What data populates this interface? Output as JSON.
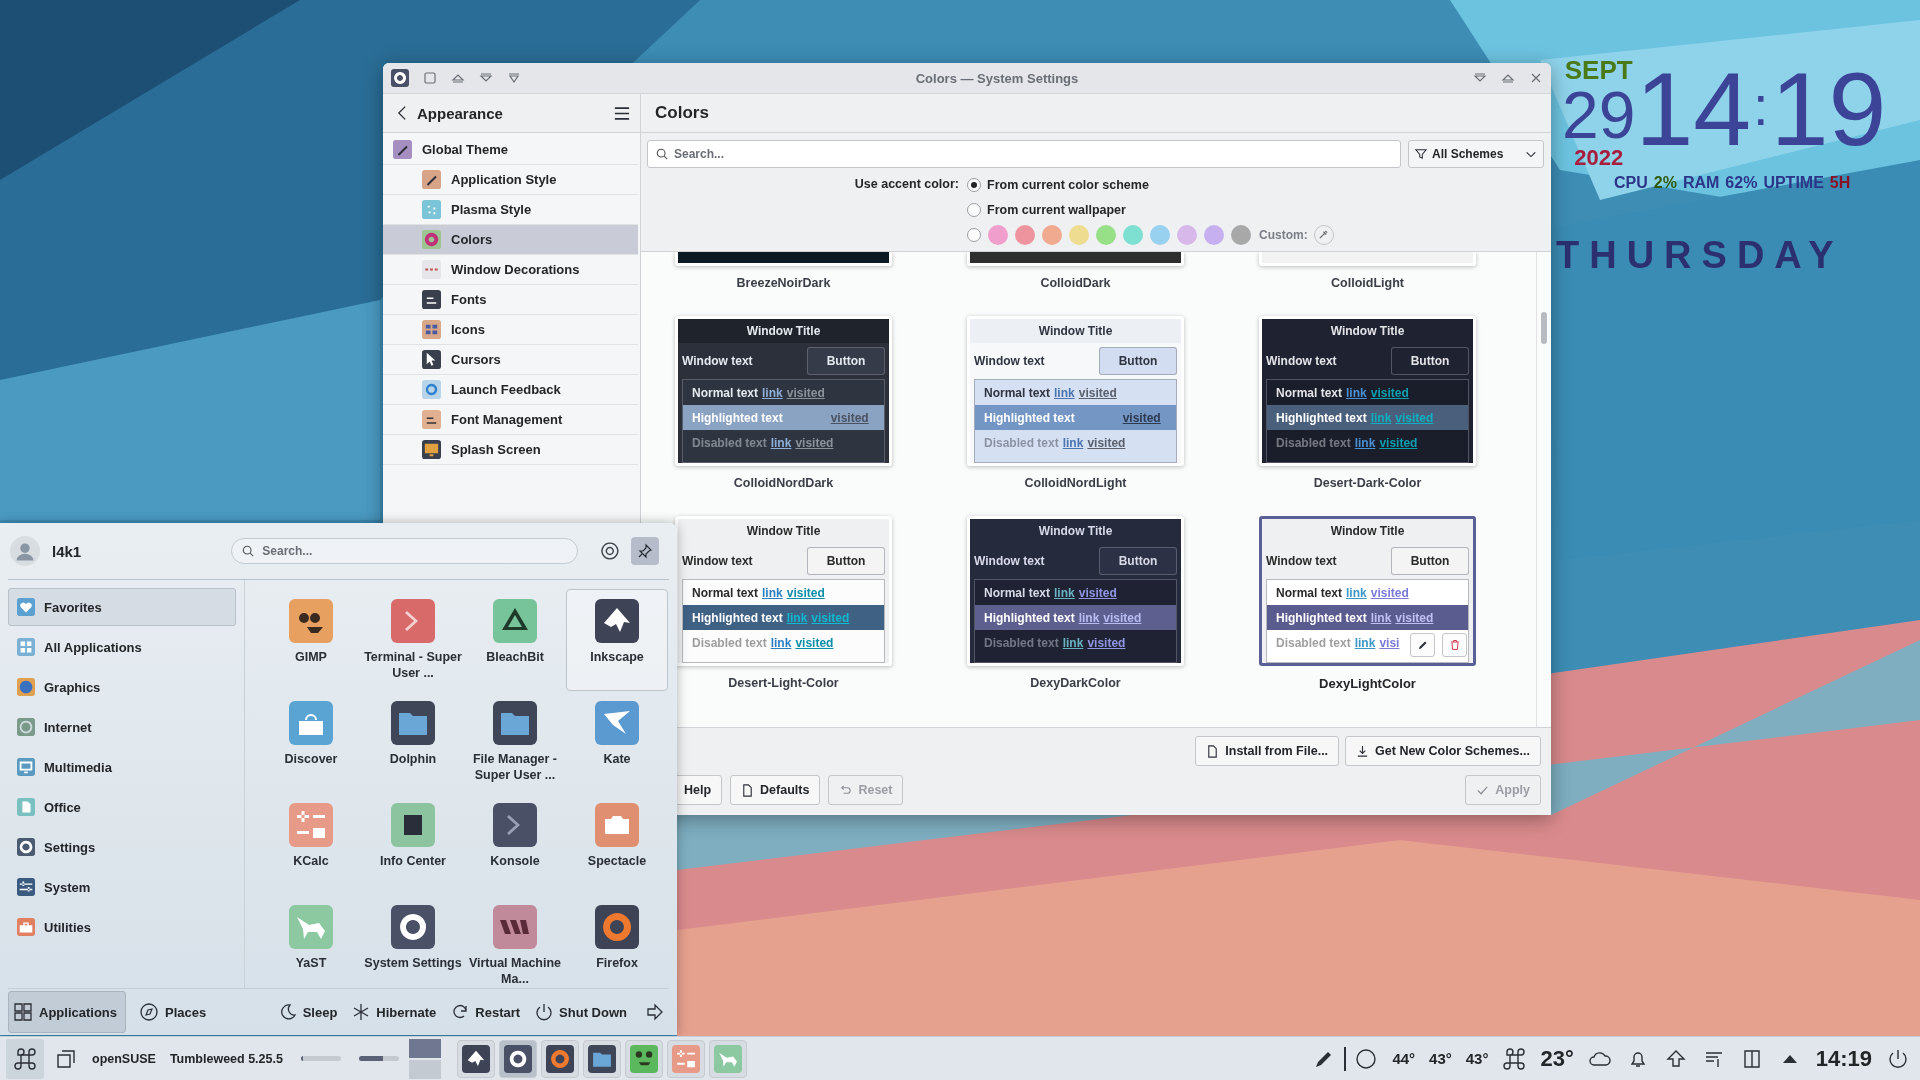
{
  "clock": {
    "month": "SEPT",
    "day": "29",
    "year": "2022",
    "hours": "14",
    "separator": ":",
    "minutes": "19",
    "stats": [
      {
        "label": "CPU",
        "value": "2%"
      },
      {
        "label": "RAM",
        "value": "62%"
      },
      {
        "label": "UPTIME",
        "value": "5H"
      }
    ],
    "weekday": "THURSDAY"
  },
  "window": {
    "title": "Colors — System Settings"
  },
  "sidebar": {
    "title": "Appearance",
    "items": [
      {
        "label": "Global Theme",
        "selected": false,
        "children": [
          {
            "label": "Application Style",
            "selected": false
          },
          {
            "label": "Plasma Style",
            "selected": false
          },
          {
            "label": "Colors",
            "selected": true
          },
          {
            "label": "Window Decorations",
            "selected": false
          },
          {
            "label": "Fonts",
            "selected": false
          },
          {
            "label": "Icons",
            "selected": false
          },
          {
            "label": "Cursors",
            "selected": false
          },
          {
            "label": "Launch Feedback",
            "selected": false
          },
          {
            "label": "Font Management",
            "selected": false
          },
          {
            "label": "Splash Screen",
            "selected": false
          }
        ]
      }
    ]
  },
  "page": {
    "title": "Colors",
    "search": {
      "placeholder": "Search..."
    },
    "filter": "All Schemes",
    "accent": {
      "label": "Use accent color:",
      "options": [
        {
          "kind": "text",
          "label": "From current color scheme",
          "selected": true
        },
        {
          "kind": "text",
          "label": "From current wallpaper",
          "selected": false
        },
        {
          "kind": "swatches",
          "selected": false
        }
      ],
      "swatches": [
        {
          "color": "#f09ecb"
        },
        {
          "color": "#ee949e"
        },
        {
          "color": "#f0aa90"
        },
        {
          "color": "#eedc90"
        },
        {
          "color": "#98e088"
        },
        {
          "color": "#7ee0d0"
        },
        {
          "color": "#98d0f0"
        },
        {
          "color": "#d8b8ea"
        },
        {
          "color": "#c6b0f0"
        },
        {
          "color": "#a8a8a8"
        }
      ],
      "custom": "Custom:"
    },
    "schemes": [
      {
        "name": "BreezeNoirDark",
        "selected": false,
        "kind": "cut"
      },
      {
        "name": "ColloidDark",
        "selected": false,
        "kind": "cut"
      },
      {
        "name": "ColloidLight",
        "selected": false,
        "kind": "cut"
      },
      {
        "name": "ColloidNordDark",
        "selected": false,
        "kind": "full",
        "preview": {
          "title": "Window Title",
          "text": "Window text",
          "button": "Button",
          "rows": [
            {
              "kind": "normal",
              "text": "Normal text",
              "link": "link",
              "visited": "visited"
            },
            {
              "kind": "highlighted",
              "text": "Highlighted text",
              "visited": "visited"
            },
            {
              "kind": "disabled",
              "text": "Disabled text",
              "link": "link",
              "visited": "visited"
            }
          ]
        }
      },
      {
        "name": "ColloidNordLight",
        "selected": false,
        "kind": "full",
        "preview": {
          "title": "Window Title",
          "text": "Window text",
          "button": "Button",
          "rows": [
            {
              "kind": "normal",
              "text": "Normal text",
              "link": "link",
              "visited": "visited"
            },
            {
              "kind": "highlighted",
              "text": "Highlighted text",
              "visited": "visited"
            },
            {
              "kind": "disabled",
              "text": "Disabled text",
              "link": "link",
              "visited": "visited"
            }
          ]
        }
      },
      {
        "name": "Desert-Dark-Color",
        "selected": false,
        "kind": "full",
        "preview": {
          "title": "Window Title",
          "text": "Window text",
          "button": "Button",
          "rows": [
            {
              "kind": "normal",
              "text": "Normal text",
              "link": "link",
              "visited": "visited"
            },
            {
              "kind": "highlighted",
              "text": "Highlighted text",
              "link": "link",
              "visited": "visited"
            },
            {
              "kind": "disabled",
              "text": "Disabled text",
              "link": "link",
              "visited": "visited"
            }
          ]
        }
      },
      {
        "name": "Desert-Light-Color",
        "selected": false,
        "kind": "full",
        "preview": {
          "title": "Window Title",
          "text": "Window text",
          "button": "Button",
          "rows": [
            {
              "kind": "normal",
              "text": "Normal text",
              "link": "link",
              "visited": "visited"
            },
            {
              "kind": "highlighted",
              "text": "Highlighted text",
              "link": "link",
              "visited": "visited"
            },
            {
              "kind": "disabled",
              "text": "Disabled text",
              "link": "link",
              "visited": "visited"
            }
          ]
        }
      },
      {
        "name": "DexyDarkColor",
        "selected": false,
        "kind": "full",
        "preview": {
          "title": "Window Title",
          "text": "Window text",
          "button": "Button",
          "rows": [
            {
              "kind": "normal",
              "text": "Normal text",
              "link": "link",
              "visited": "visited"
            },
            {
              "kind": "highlighted",
              "text": "Highlighted text",
              "link": "link",
              "visited": "visited"
            },
            {
              "kind": "disabled",
              "text": "Disabled text",
              "link": "link",
              "visited": "visited"
            }
          ]
        }
      },
      {
        "name": "DexyLightColor",
        "selected": true,
        "kind": "full",
        "preview": {
          "title": "Window Title",
          "text": "Window text",
          "button": "Button",
          "rows": [
            {
              "kind": "normal",
              "text": "Normal text",
              "link": "link",
              "visited": "visited"
            },
            {
              "kind": "highlighted",
              "text": "Highlighted text",
              "link": "link",
              "visited": "visited"
            },
            {
              "kind": "disabled",
              "text": "Disabled text",
              "link": "link",
              "visited": "visi"
            }
          ]
        }
      }
    ],
    "actions": [
      {
        "kind": "install",
        "label": "Install from File..."
      },
      {
        "kind": "download",
        "label": "Get New Color Schemes..."
      }
    ]
  },
  "footer": {
    "buttons": [
      {
        "kind": "help",
        "label": "Help",
        "disabled": false
      },
      {
        "kind": "defaults",
        "label": "Defaults",
        "disabled": false
      },
      {
        "kind": "reset",
        "label": "Reset",
        "disabled": true
      }
    ],
    "apply": {
      "label": "Apply",
      "disabled": true
    }
  },
  "launcher": {
    "user": "l4k1",
    "search": {
      "placeholder": "Search..."
    },
    "pinned": true,
    "categories": [
      {
        "label": "Favorites",
        "selected": true
      },
      {
        "label": "All Applications",
        "selected": false
      },
      {
        "label": "Graphics",
        "selected": false
      },
      {
        "label": "Internet",
        "selected": false
      },
      {
        "label": "Multimedia",
        "selected": false
      },
      {
        "label": "Office",
        "selected": false
      },
      {
        "label": "Settings",
        "selected": false
      },
      {
        "label": "System",
        "selected": false
      },
      {
        "label": "Utilities",
        "selected": false
      }
    ],
    "apps": [
      {
        "kind": "gimp",
        "name": "GIMP",
        "selected": false
      },
      {
        "kind": "terminal",
        "name": "Terminal - Super User ...",
        "selected": false
      },
      {
        "kind": "bleachbit",
        "name": "BleachBit",
        "selected": false
      },
      {
        "kind": "inkscape",
        "name": "Inkscape",
        "selected": true
      },
      {
        "kind": "discover",
        "name": "Discover",
        "selected": false
      },
      {
        "kind": "dolphin",
        "name": "Dolphin",
        "selected": false
      },
      {
        "kind": "filemanager",
        "name": "File Manager - Super User ...",
        "selected": false
      },
      {
        "kind": "kate",
        "name": "Kate",
        "selected": false
      },
      {
        "kind": "kcalc",
        "name": "KCalc",
        "selected": false
      },
      {
        "kind": "infocenter",
        "name": "Info Center",
        "selected": false
      },
      {
        "kind": "konsole",
        "name": "Konsole",
        "selected": false
      },
      {
        "kind": "spectacle",
        "name": "Spectacle",
        "selected": false
      },
      {
        "kind": "yast",
        "name": "YaST",
        "selected": false
      },
      {
        "kind": "settings",
        "name": "System Settings",
        "selected": false
      },
      {
        "kind": "vm",
        "name": "Virtual Machine Ma...",
        "selected": false
      },
      {
        "kind": "firefox",
        "name": "Firefox",
        "selected": false
      }
    ],
    "tabs": [
      {
        "kind": "applications",
        "label": "Applications",
        "selected": true
      },
      {
        "kind": "places",
        "label": "Places",
        "selected": false
      }
    ],
    "power": [
      {
        "kind": "sleep",
        "label": "Sleep"
      },
      {
        "kind": "hibernate",
        "label": "Hibernate"
      },
      {
        "kind": "restart",
        "label": "Restart"
      },
      {
        "kind": "shutdown",
        "label": "Shut Down"
      }
    ]
  },
  "taskbar": {
    "os": "openSUSE",
    "version": "Tumbleweed 5.25.5",
    "meters": [
      {
        "level": 0.05
      },
      {
        "level": 0.6
      }
    ],
    "desktops": [
      {
        "selected": true
      },
      {
        "selected": false
      }
    ],
    "tasks": [
      {
        "kind": "inkscape",
        "active": false
      },
      {
        "kind": "settings",
        "active": true
      },
      {
        "kind": "firefox",
        "active": false
      },
      {
        "kind": "dolphin",
        "active": false
      },
      {
        "kind": "frog",
        "active": false
      },
      {
        "kind": "kcalc",
        "active": false
      },
      {
        "kind": "yast",
        "active": false
      }
    ],
    "temps": [
      "44°",
      "43°",
      "43°"
    ],
    "weather": "23°",
    "time": "14:19"
  }
}
